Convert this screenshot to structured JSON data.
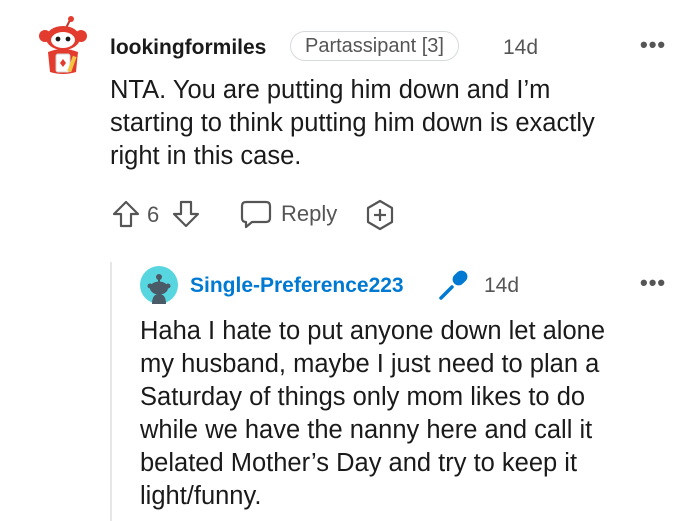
{
  "comment": {
    "avatar_icon": "snoo-avatar-icon",
    "username": "lookingformiles",
    "flair": "Partassipant [3]",
    "time": "14d",
    "more_icon": "•••",
    "body_lines": [
      "NTA. You are putting him down and I’m",
      "starting to think putting him down is exactly",
      "right in this case."
    ],
    "actions": {
      "vote_count": "6",
      "reply_label": "Reply"
    }
  },
  "reply": {
    "avatar_icon": "snoo-avatar-icon",
    "username": "Single-Preference223",
    "op_badge_icon": "microphone-icon",
    "time": "14d",
    "more_icon": "•••",
    "body_lines": [
      "Haha I hate to put anyone down let alone",
      "my husband, maybe I just need to plan a",
      "Saturday of things only mom likes to do",
      "while we have the nanny here and call it",
      "belated Mother’s Day and try to keep it",
      "light/funny."
    ]
  },
  "colors": {
    "username_reply": "#0079d3",
    "avatar_red": "#e33b2e",
    "avatar_teal": "#58d6e0",
    "mic_blue": "#0079d3"
  }
}
